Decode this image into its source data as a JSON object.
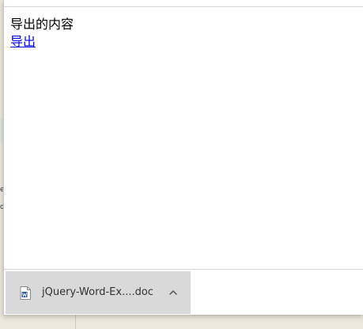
{
  "backdrop": {
    "partial_chars": [
      "e",
      "o"
    ]
  },
  "page": {
    "title_text": "导出的内容",
    "export_link": "导出"
  },
  "download": {
    "file_name": "jQuery-Word-Ex....doc",
    "file_icon": "word-document-icon",
    "menu_icon": "chevron-up-icon"
  },
  "colors": {
    "link": "#0000ee",
    "download_item_bg": "#d9d9d9",
    "word_icon_blue": "#2b5797",
    "backdrop": "#ece8db"
  }
}
